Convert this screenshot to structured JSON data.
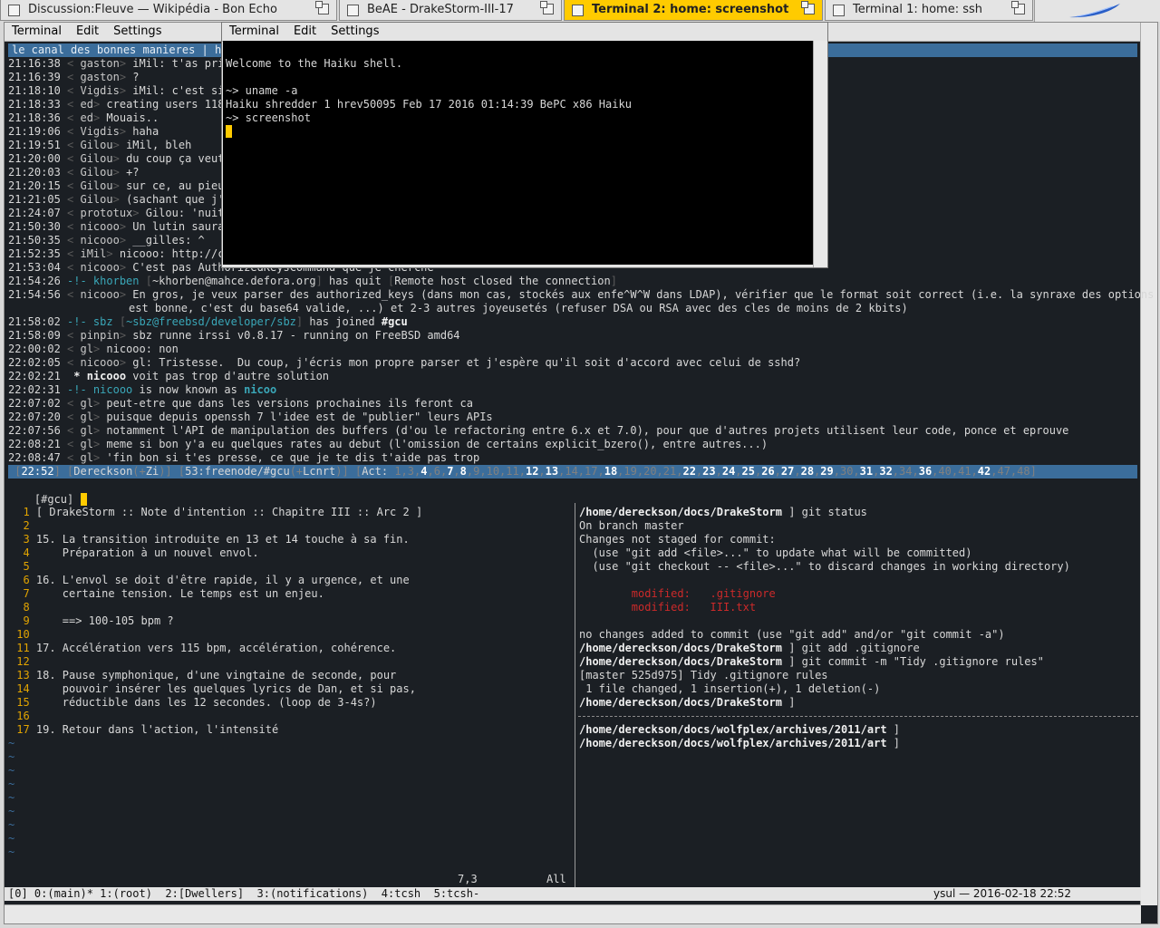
{
  "tabs": [
    {
      "title": "Discussion:Fleuve — Wikipédia - Bon Echo",
      "active": false
    },
    {
      "title": "BeAE - DrakeStorm-III-17",
      "active": false
    },
    {
      "title": "Terminal 2: home: screenshot",
      "active": true
    },
    {
      "title": "Terminal 1: home: ssh",
      "active": false
    }
  ],
  "main_menu": [
    "Terminal",
    "Edit",
    "Settings"
  ],
  "front_menu": [
    "Terminal",
    "Edit",
    "Settings"
  ],
  "topic": "le canal des bonnes manieres | h",
  "irc_lines": [
    {
      "time": "21:16:38",
      "nick": "gaston",
      "text": "iMil: t'as pris"
    },
    {
      "time": "21:16:39",
      "nick": "gaston",
      "text": "?"
    },
    {
      "time": "21:18:10",
      "nick": "Vigdis",
      "text": "iMil: c'est sin"
    },
    {
      "time": "21:18:33",
      "nick": "ed",
      "text": "creating users 118"
    },
    {
      "time": "21:18:36",
      "nick": "ed",
      "text": "Mouais.."
    },
    {
      "time": "21:19:06",
      "nick": "Vigdis",
      "text": "haha"
    },
    {
      "time": "21:19:51",
      "nick": "Gilou",
      "text": "iMil, bleh"
    },
    {
      "time": "21:20:00",
      "nick": "Gilou",
      "text": "du coup ça veut"
    },
    {
      "time": "21:20:03",
      "nick": "Gilou",
      "text": "+?"
    },
    {
      "time": "21:20:15",
      "nick": "Gilou",
      "text": "sur ce, au pieu"
    },
    {
      "time": "21:21:05",
      "nick": "Gilou",
      "text": "(sachant que j'a"
    },
    {
      "time": "21:24:07",
      "nick": "prototux",
      "text": "Gilou: 'nuit"
    },
    {
      "time": "21:50:30",
      "nick": "nicooo",
      "text": "Un lutin saurai                                                                     s clefs publiques)"
    },
    {
      "time": "21:50:35",
      "nick": "nicooo",
      "text": "__gilles: ^"
    },
    {
      "time": "21:52:35",
      "nick": "iMil",
      "text": "nicooo: http://c                                                                   oudSSH.-Nan-j-deconne ?"
    },
    {
      "time": "21:53:04",
      "nick": "nicooo",
      "text": "C'est pas AuthorizedKeysCommand que je cherche"
    }
  ],
  "quit_line": {
    "time": "21:54:26",
    "nick": "khorben",
    "host": "~khorben@mahce.defora.org",
    "text": "has quit",
    "reason": "Remote host closed the connection"
  },
  "long_line": {
    "time": "21:54:56",
    "nick": "nicooo",
    "text1": "En gros, je veux parser des authorized_keys (dans mon cas, stockés aux enfe^W^W dans LDAP), vérifier que le format soit correct (i.e. la synraxe des options",
    "text2": "est bonne, c'est du base64 valide, ...) et 2-3 autres joyeusetés (refuser DSA ou RSA avec des cles de moins de 2 kbits)"
  },
  "join_line": {
    "time": "21:58:02",
    "nick": "sbz",
    "host": "~sbz@freebsd/developer/sbz",
    "text": "has joined",
    "chan": "#gcu"
  },
  "irc_lines2": [
    {
      "time": "21:58:09",
      "nick": "pinpin",
      "text": "sbz runne irssi v0.8.17 - running on FreeBSD amd64"
    },
    {
      "time": "22:00:02",
      "nick": "gl",
      "text": "nicooo: non"
    },
    {
      "time": "22:02:05",
      "nick": "nicooo",
      "text": "gl: Tristesse.  Du coup, j'écris mon propre parser et j'espère qu'il soit d'accord avec celui de sshd?"
    }
  ],
  "action_line": {
    "time": "22:02:21",
    "nick": "nicooo",
    "text": "voit pas trop d'autre solution"
  },
  "nick_line": {
    "time": "22:02:31",
    "old": "nicooo",
    "text": "is now known as",
    "new": "nicoo"
  },
  "irc_lines3": [
    {
      "time": "22:07:02",
      "nick": "gl",
      "text": "peut-etre que dans les versions prochaines ils feront ca"
    },
    {
      "time": "22:07:20",
      "nick": "gl",
      "text": "puisque depuis openssh 7 l'idee est de \"publier\" leurs APIs"
    },
    {
      "time": "22:07:56",
      "nick": "gl",
      "text": "notamment l'API de manipulation des buffers (d'ou le refactoring entre 6.x et 7.0), pour que d'autres projets utilisent leur code, ponce et eprouve"
    },
    {
      "time": "22:08:21",
      "nick": "gl",
      "text": "meme si bon y'a eu quelques rates au debut (l'omission de certains explicit_bzero(), entre autres...)"
    },
    {
      "time": "22:08:47",
      "nick": "gl",
      "text": "'fin bon si t'es presse, ce que je te dis t'aide pas trop"
    }
  ],
  "status": {
    "time": "22:52",
    "nick": "Dereckson",
    "mode": "Zi",
    "win": "53:freenode/#gcu",
    "cmode": "Lcnrt",
    "act_label": "Act:",
    "act": [
      [
        "1,3",
        0
      ],
      [
        "4",
        1
      ],
      [
        "6",
        0
      ],
      [
        "7",
        1
      ],
      [
        "8",
        1
      ],
      [
        "9",
        0
      ],
      [
        "10",
        0
      ],
      [
        "11",
        0
      ],
      [
        "12",
        1
      ],
      [
        "13",
        1
      ],
      [
        "14",
        0
      ],
      [
        "17",
        0
      ],
      [
        "18",
        1
      ],
      [
        "19",
        0
      ],
      [
        "20",
        0
      ],
      [
        "21",
        0
      ],
      [
        "22",
        1
      ],
      [
        "23",
        1
      ],
      [
        "24",
        1
      ],
      [
        "25",
        1
      ],
      [
        "26",
        1
      ],
      [
        "27",
        1
      ],
      [
        "28",
        1
      ],
      [
        "29",
        1
      ],
      [
        "30",
        0
      ],
      [
        "31",
        1
      ],
      [
        "32",
        1
      ],
      [
        "34",
        0
      ],
      [
        "36",
        1
      ],
      [
        "40",
        0
      ],
      [
        "41",
        0
      ],
      [
        "42",
        1
      ],
      [
        "47",
        0
      ],
      [
        "48",
        0
      ]
    ]
  },
  "prompt": "[#gcu]",
  "vim_lines": [
    {
      "n": "1",
      "t": "[ DrakeStorm :: Note d'intention :: Chapitre III :: Arc 2 ]"
    },
    {
      "n": "2",
      "t": ""
    },
    {
      "n": "3",
      "t": "15. La transition introduite en 13 et 14 touche à sa fin."
    },
    {
      "n": "4",
      "t": "    Préparation à un nouvel envol."
    },
    {
      "n": "5",
      "t": ""
    },
    {
      "n": "6",
      "t": "16. L'envol se doit d'être rapide, il y a urgence, et une"
    },
    {
      "n": "7",
      "t": "    certaine tension. Le temps est un enjeu."
    },
    {
      "n": "8",
      "t": ""
    },
    {
      "n": "9",
      "t": "    ==> 100-105 bpm ?"
    },
    {
      "n": "10",
      "t": ""
    },
    {
      "n": "11",
      "t": "17. Accélération vers 115 bpm, accélération, cohérence."
    },
    {
      "n": "12",
      "t": ""
    },
    {
      "n": "13",
      "t": "18. Pause symphonique, d'une vingtaine de seconde, pour"
    },
    {
      "n": "14",
      "t": "    pouvoir insérer les quelques lyrics de Dan, et si pas,"
    },
    {
      "n": "15",
      "t": "    réductible dans les 12 secondes. (loop de 3-4s?)"
    },
    {
      "n": "16",
      "t": ""
    },
    {
      "n": "17",
      "t": "19. Retour dans l'action, l'intensité"
    }
  ],
  "vim_tilde": "~",
  "vim_ruler": {
    "pos": "7,3",
    "all": "All"
  },
  "git_lines": [
    {
      "p": "/home/dereckson/docs/DrakeStorm",
      "t": " ] git status"
    },
    {
      "p": "",
      "t": "On branch master"
    },
    {
      "p": "",
      "t": "Changes not staged for commit:"
    },
    {
      "p": "",
      "t": "  (use \"git add <file>...\" to update what will be committed)"
    },
    {
      "p": "",
      "t": "  (use \"git checkout -- <file>...\" to discard changes in working directory)"
    },
    {
      "p": "",
      "t": ""
    },
    {
      "p": "",
      "t": "        modified:   .gitignore",
      "red": true
    },
    {
      "p": "",
      "t": "        modified:   III.txt",
      "red": true
    },
    {
      "p": "",
      "t": ""
    },
    {
      "p": "",
      "t": "no changes added to commit (use \"git add\" and/or \"git commit -a\")"
    },
    {
      "p": "/home/dereckson/docs/DrakeStorm",
      "t": " ] git add .gitignore"
    },
    {
      "p": "/home/dereckson/docs/DrakeStorm",
      "t": " ] git commit -m \"Tidy .gitignore rules\""
    },
    {
      "p": "",
      "t": "[master 525d975] Tidy .gitignore rules"
    },
    {
      "p": "",
      "t": " 1 file changed, 1 insertion(+), 1 deletion(-)"
    },
    {
      "p": "/home/dereckson/docs/DrakeStorm",
      "t": " ]"
    }
  ],
  "pane_lines": [
    {
      "p": "/home/dereckson/docs/wolfplex/archives/2011/art",
      "t": " ]"
    },
    {
      "p": "/home/dereckson/docs/wolfplex/archives/2011/art",
      "t": " ]"
    }
  ],
  "tmux": {
    "windows": "[0] 0:(main)* 1:(root)  2:[Dwellers]  3:(notifications)  4:tcsh  5:tcsh-",
    "right": "ysul — 2016-02-18 22:52"
  },
  "haiku": {
    "lines": [
      "Welcome to the Haiku shell.",
      "",
      "~> uname -a",
      "Haiku shredder 1 hrev50095 Feb 17 2016 01:14:39 BePC x86 Haiku",
      "~> screenshot"
    ]
  }
}
